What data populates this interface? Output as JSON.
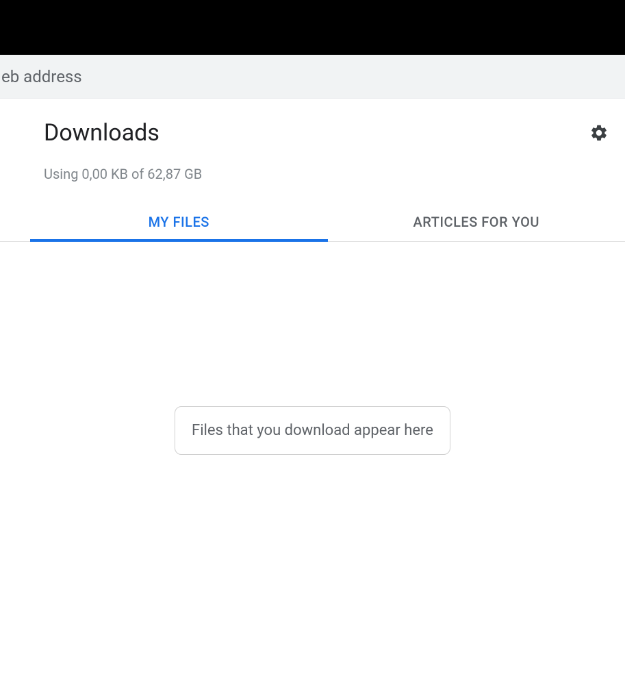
{
  "address_bar": {
    "partial_text": "eb address"
  },
  "header": {
    "title": "Downloads",
    "settings_icon": "gear-icon"
  },
  "storage": {
    "usage_text": "Using 0,00 KB of 62,87 GB"
  },
  "tabs": [
    {
      "label": "MY FILES",
      "active": true
    },
    {
      "label": "ARTICLES FOR YOU",
      "active": false
    }
  ],
  "empty_state": {
    "message": "Files that you download appear here"
  },
  "colors": {
    "accent": "#1a73e8",
    "text_primary": "#202124",
    "text_secondary": "#5f6368"
  }
}
